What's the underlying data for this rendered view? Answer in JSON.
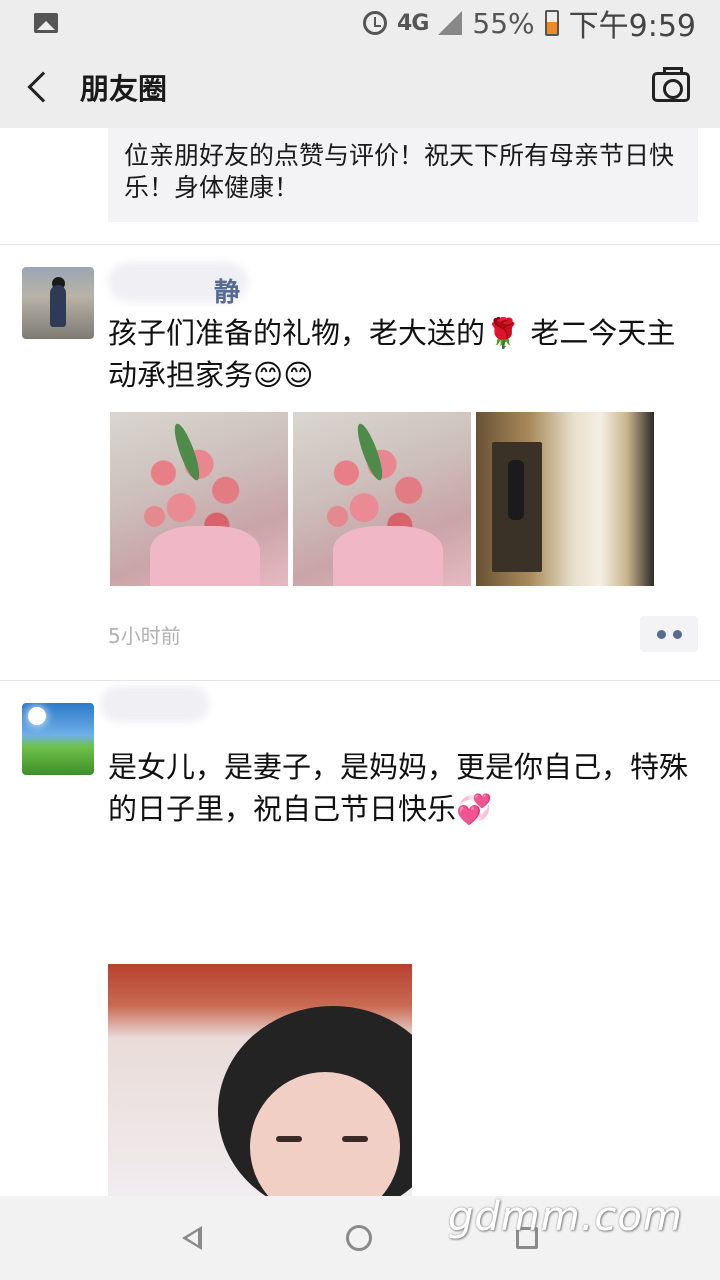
{
  "status_bar": {
    "network": "4G",
    "battery": "55%",
    "time": "下午9:59"
  },
  "header": {
    "title": "朋友圈"
  },
  "previous_comment": {
    "text": "位亲朋好友的点赞与评价！祝天下所有母亲节日快乐！身体健康！"
  },
  "posts": [
    {
      "name_partial": "静",
      "text": "孩子们准备的礼物，老大送的🌹 老二今天主动承担家务😊😊",
      "time": "5小时前"
    },
    {
      "name_partial": "",
      "text": "是女儿，是妻子，是妈妈，更是你自己，特殊的日子里，祝自己节日快乐💞"
    }
  ],
  "watermark": "gdmm.com"
}
